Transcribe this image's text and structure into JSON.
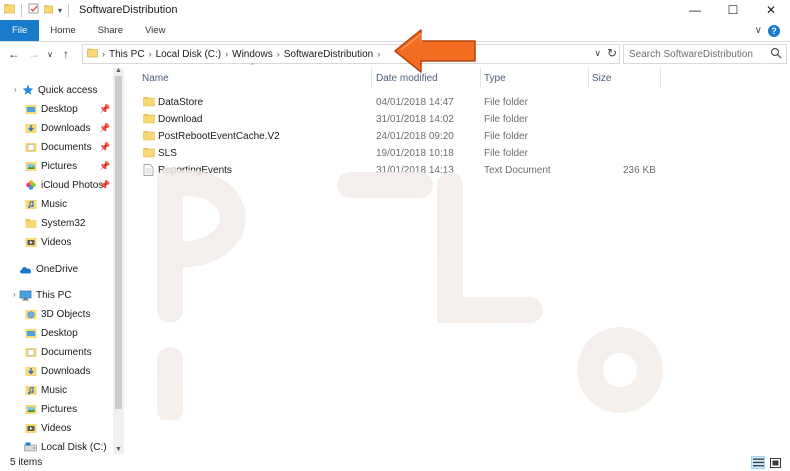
{
  "window": {
    "title": "SoftwareDistribution",
    "minimize": "—",
    "maximize": "☐",
    "close": "✕"
  },
  "ribbon": {
    "tabs": [
      "File",
      "Home",
      "Share",
      "View"
    ],
    "expand": "∨"
  },
  "address": {
    "crumbs": [
      "This PC",
      "Local Disk (C:)",
      "Windows",
      "SoftwareDistribution"
    ],
    "search_placeholder": "Search SoftwareDistribution"
  },
  "nav": {
    "quick_access": "Quick access",
    "quick_items": [
      "Desktop",
      "Downloads",
      "Documents",
      "Pictures",
      "iCloud Photos",
      "Music",
      "System32",
      "Videos"
    ],
    "onedrive": "OneDrive",
    "this_pc": "This PC",
    "pc_items": [
      "3D Objects",
      "Desktop",
      "Documents",
      "Downloads",
      "Music",
      "Pictures",
      "Videos",
      "Local Disk (C:)"
    ]
  },
  "columns": {
    "name": "Name",
    "date": "Date modified",
    "type": "Type",
    "size": "Size"
  },
  "files": [
    {
      "name": "DataStore",
      "date": "04/01/2018 14:47",
      "type": "File folder",
      "size": "",
      "kind": "folder"
    },
    {
      "name": "Download",
      "date": "31/01/2018 14:02",
      "type": "File folder",
      "size": "",
      "kind": "folder"
    },
    {
      "name": "PostRebootEventCache.V2",
      "date": "24/01/2018 09:20",
      "type": "File folder",
      "size": "",
      "kind": "folder"
    },
    {
      "name": "SLS",
      "date": "19/01/2018 10:18",
      "type": "File folder",
      "size": "",
      "kind": "folder"
    },
    {
      "name": "ReportingEvents",
      "date": "31/01/2018 14:13",
      "type": "Text Document",
      "size": "236 KB",
      "kind": "text"
    }
  ],
  "status": {
    "count": "5 items"
  },
  "colors": {
    "accent": "#1979ca",
    "folder": "#f8d775",
    "arrow": "#f26d21"
  }
}
